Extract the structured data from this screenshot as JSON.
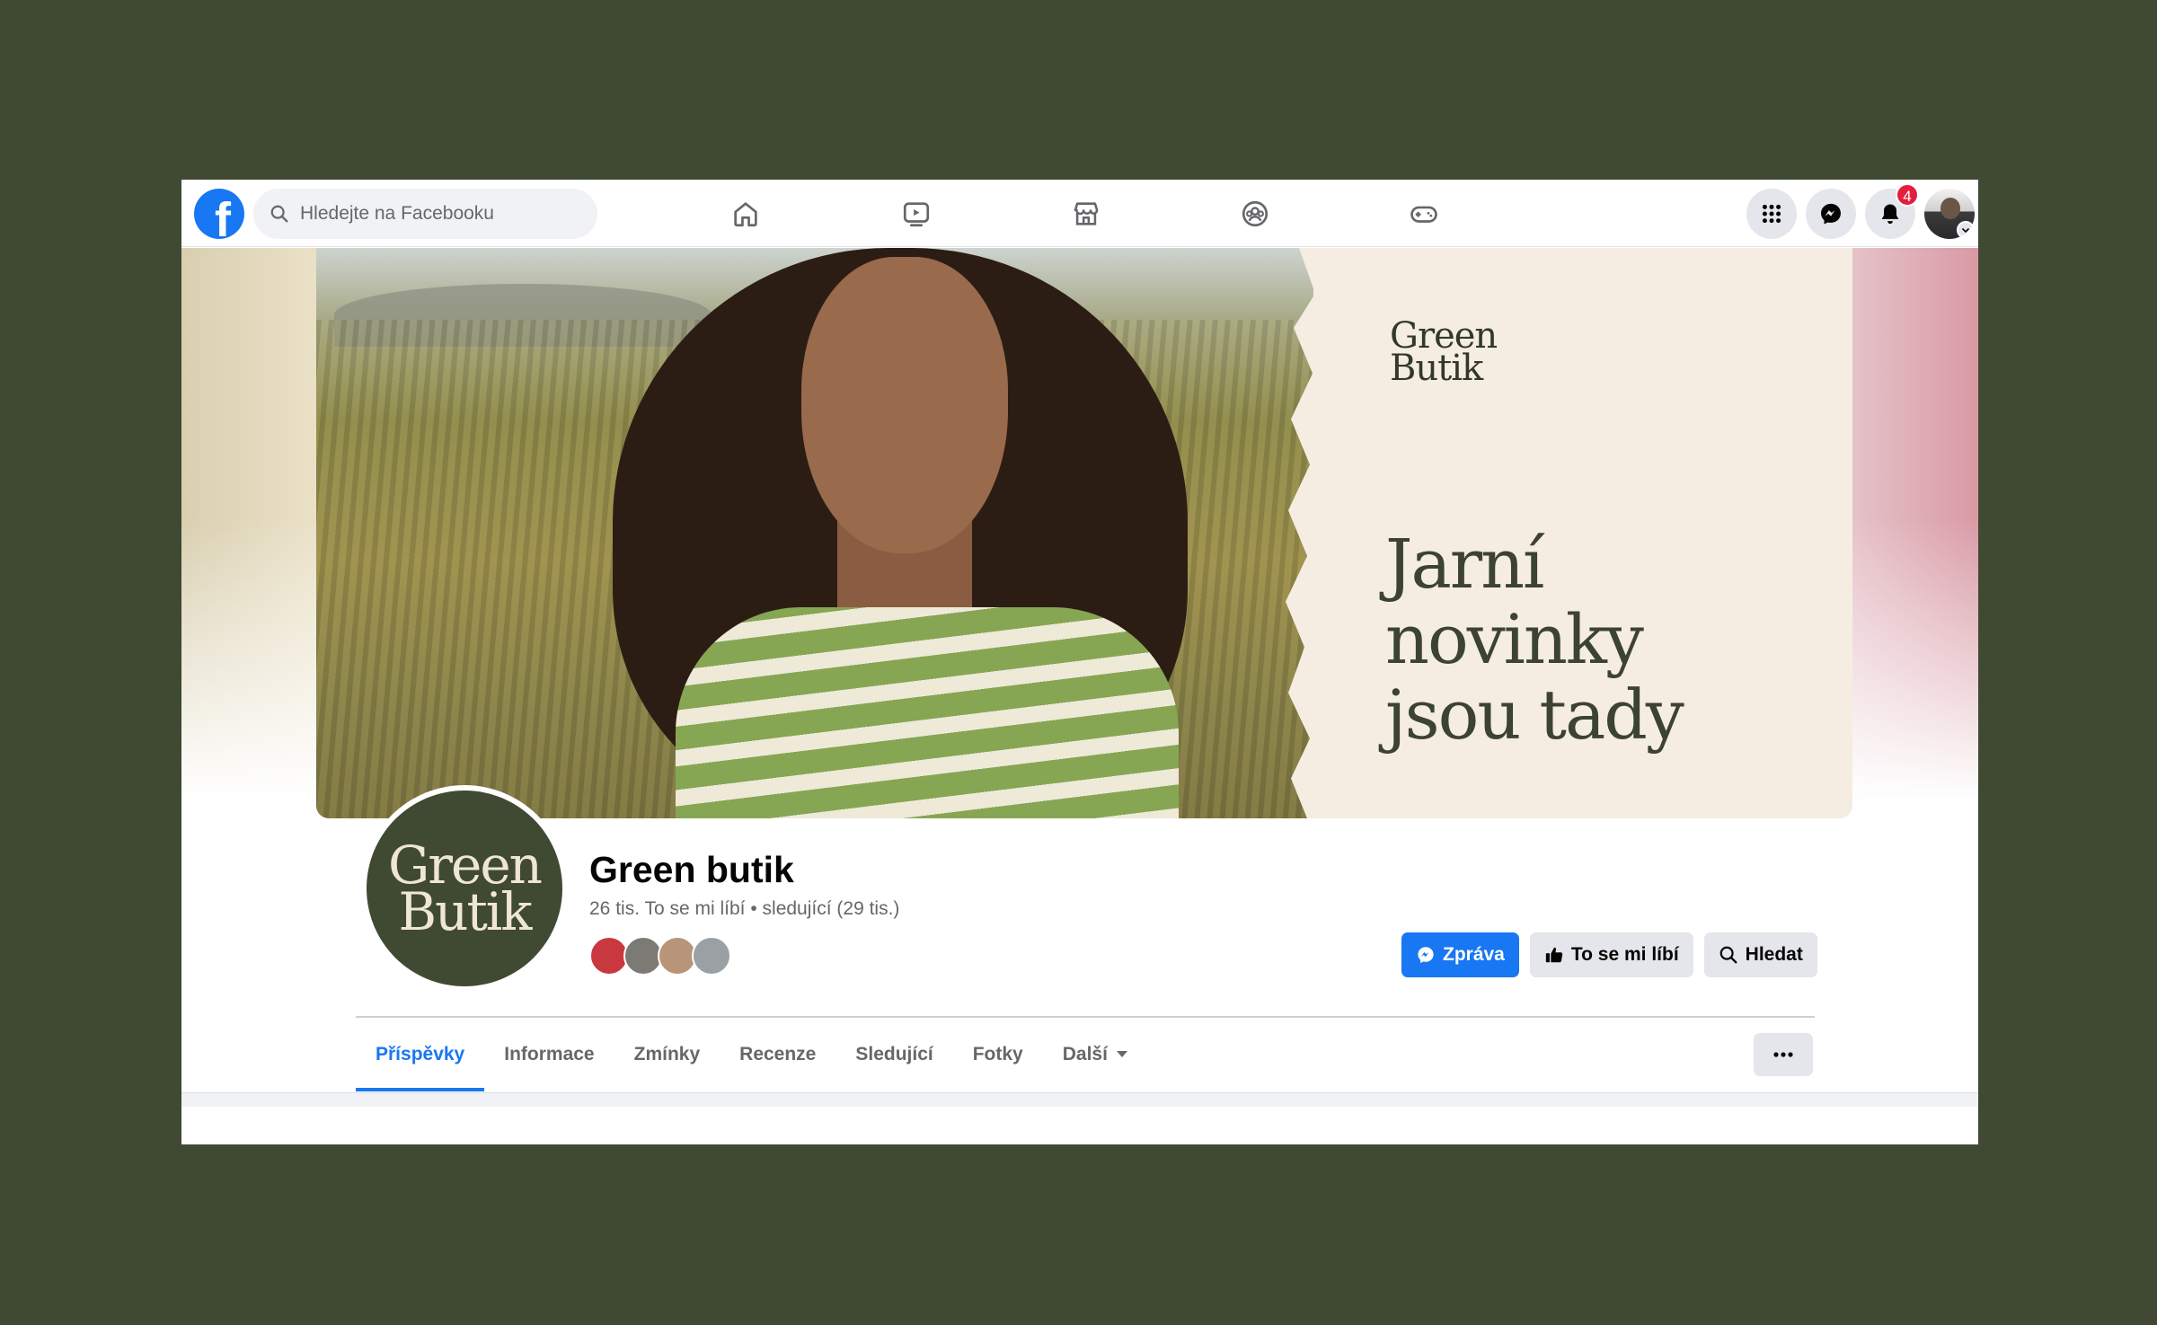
{
  "topbar": {
    "logo_letter": "f",
    "search_placeholder": "Hledejte na Facebooku",
    "nav_icons": [
      "home-icon",
      "watch-icon",
      "marketplace-icon",
      "groups-icon",
      "gaming-icon"
    ],
    "notifications_count": "4"
  },
  "cover": {
    "brand_line1": "Green",
    "brand_line2": "Butik",
    "headline_line1": "Jarní",
    "headline_line2": "novinky",
    "headline_line3": "jsou tady"
  },
  "profile": {
    "logo_line1": "Green",
    "logo_line2": "Butik",
    "name": "Green butik",
    "stats": "26 tis. To se mi líbí • sledující (29 tis.)",
    "friend_colors": [
      "#c9383f",
      "#7c7a74",
      "#b89478",
      "#9aa0a3"
    ]
  },
  "actions": {
    "message_label": "Zpráva",
    "like_label": "To se mi líbí",
    "search_label": "Hledat"
  },
  "tabs": [
    {
      "label": "Příspěvky"
    },
    {
      "label": "Informace"
    },
    {
      "label": "Zmínky"
    },
    {
      "label": "Recenze"
    },
    {
      "label": "Sledující"
    },
    {
      "label": "Fotky"
    },
    {
      "label": "Další"
    }
  ],
  "colors": {
    "outer_background": "#404a32",
    "facebook_blue": "#1877f2",
    "brand_green": "#404a32"
  }
}
